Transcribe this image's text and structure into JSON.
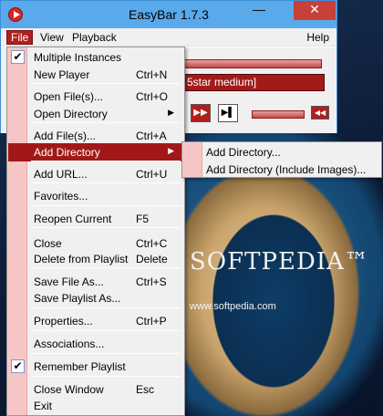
{
  "window": {
    "title": "EasyBar 1.7.3",
    "minimize_glyph": "—",
    "close_glyph": "✕",
    "icon": "play-icon"
  },
  "menubar": {
    "file": "File",
    "view": "View",
    "playback": "Playback",
    "help": "Help"
  },
  "player": {
    "now_playing": "5star medium]",
    "fast_forward_glyph": "▶▶",
    "next_glyph": "▶▌",
    "small_button_glyph": "◀◀"
  },
  "file_menu": {
    "items": [
      {
        "label": "Multiple Instances",
        "shortcut": "",
        "checked": true
      },
      {
        "label": "New Player",
        "shortcut": "Ctrl+N"
      },
      {
        "label": "Open File(s)...",
        "shortcut": "Ctrl+O"
      },
      {
        "label": "Open Directory",
        "shortcut": "",
        "submenu": true
      },
      {
        "label": "Add File(s)...",
        "shortcut": "Ctrl+A"
      },
      {
        "label": "Add Directory",
        "shortcut": "",
        "submenu": true,
        "highlighted": true
      },
      {
        "label": "Add URL...",
        "shortcut": "Ctrl+U"
      },
      {
        "label": "Favorites...",
        "shortcut": ""
      },
      {
        "label": "Reopen Current",
        "shortcut": "F5"
      },
      {
        "label": "Close",
        "shortcut": "Ctrl+C"
      },
      {
        "label": "Delete from Playlist",
        "shortcut": "Delete"
      },
      {
        "label": "Save File As...",
        "shortcut": "Ctrl+S"
      },
      {
        "label": "Save Playlist As...",
        "shortcut": ""
      },
      {
        "label": "Properties...",
        "shortcut": "Ctrl+P"
      },
      {
        "label": "Associations...",
        "shortcut": ""
      },
      {
        "label": "Remember Playlist",
        "shortcut": "",
        "checked": true
      },
      {
        "label": "Close Window",
        "shortcut": "Esc"
      },
      {
        "label": "Exit",
        "shortcut": ""
      }
    ],
    "check_glyph": "✔",
    "submenu_arrow": "▶"
  },
  "add_directory_submenu": {
    "items": [
      {
        "label": "Add Directory..."
      },
      {
        "label": "Add Directory (Include Images)..."
      }
    ]
  },
  "background": {
    "watermark": "SOFTPEDIA™",
    "url": "www.softpedia.com"
  }
}
